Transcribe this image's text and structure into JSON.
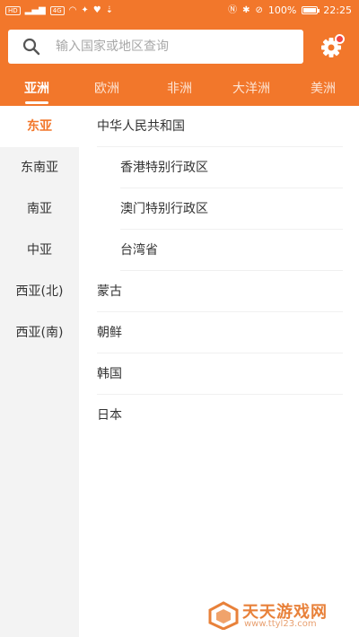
{
  "status_bar": {
    "left_chips": [
      "HD",
      "4G",
      "HD"
    ],
    "battery": "100%",
    "time": "22:25"
  },
  "search": {
    "placeholder": "输入国家或地区查询",
    "value": ""
  },
  "settings": {
    "icon": "gear-icon",
    "has_badge": true
  },
  "continent_tabs": [
    {
      "label": "亚洲",
      "active": true
    },
    {
      "label": "欧洲",
      "active": false
    },
    {
      "label": "非洲",
      "active": false
    },
    {
      "label": "大洋洲",
      "active": false
    },
    {
      "label": "美洲",
      "active": false
    }
  ],
  "regions": [
    {
      "label": "东亚",
      "active": true
    },
    {
      "label": "东南亚",
      "active": false
    },
    {
      "label": "南亚",
      "active": false
    },
    {
      "label": "中亚",
      "active": false
    },
    {
      "label": "西亚(北)",
      "active": false
    },
    {
      "label": "西亚(南)",
      "active": false
    }
  ],
  "countries": [
    {
      "label": "中华人民共和国",
      "sub": false
    },
    {
      "label": "香港特别行政区",
      "sub": true
    },
    {
      "label": "澳门特别行政区",
      "sub": true
    },
    {
      "label": "台湾省",
      "sub": true
    },
    {
      "label": "蒙古",
      "sub": false
    },
    {
      "label": "朝鲜",
      "sub": false
    },
    {
      "label": "韩国",
      "sub": false
    },
    {
      "label": "日本",
      "sub": false
    }
  ],
  "watermark": {
    "title": "天天游戏网",
    "url": "www.ttyl23.com"
  },
  "colors": {
    "accent": "#f2772b",
    "badge": "#f14444",
    "sidebar_bg": "#f3f3f3"
  }
}
